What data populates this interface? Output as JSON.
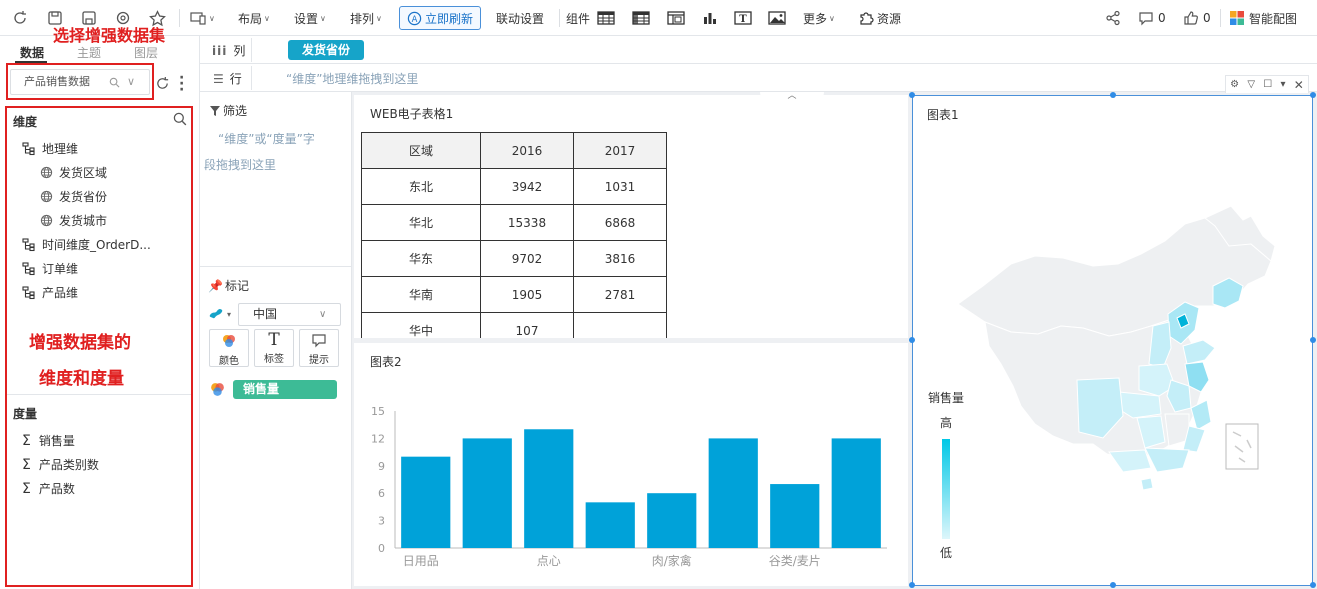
{
  "toolbar": {
    "layout": "布局",
    "settings": "设置",
    "arrange": "排列",
    "refresh": "立即刷新",
    "linkage": "联动设置",
    "component": "组件",
    "more": "更多",
    "resources": "资源",
    "comments_count": "0",
    "likes_count": "0",
    "smart_color": "智能配图"
  },
  "annotations": {
    "choose_dataset": "选择增强数据集",
    "dims_line1": "增强数据集的",
    "dims_line2": "维度和度量"
  },
  "left_panel": {
    "tabs": [
      "数据",
      "主题",
      "图层"
    ],
    "dataset_name": "产品销售数据",
    "dimension_header": "维度",
    "dimensions": [
      {
        "label": "地理维",
        "level": 0
      },
      {
        "label": "发货区域",
        "level": 1
      },
      {
        "label": "发货省份",
        "level": 1
      },
      {
        "label": "发货城市",
        "level": 1
      },
      {
        "label": "时间维度_OrderD...",
        "level": 0
      },
      {
        "label": "订单维",
        "level": 0
      },
      {
        "label": "产品维",
        "level": 0
      }
    ],
    "measure_header": "度量",
    "measures": [
      "销售量",
      "产品类别数",
      "产品数"
    ]
  },
  "shelves": {
    "col_label": "列",
    "col_pill": "发货省份",
    "row_label": "行",
    "row_hint": "“维度”地理维拖拽到这里"
  },
  "filter": {
    "label": "筛选",
    "hint_line1": "“维度”或“度量”字",
    "hint_line2": "段拖拽到这里"
  },
  "marks": {
    "label": "标记",
    "map_select": "中国",
    "buttons": [
      "颜色",
      "标签",
      "提示"
    ],
    "color_field": "销售量"
  },
  "table1": {
    "title": "WEB电子表格1",
    "header": [
      "区域",
      "2016",
      "2017"
    ],
    "rows": [
      [
        "东北",
        "3942",
        "1031"
      ],
      [
        "华北",
        "15338",
        "6868"
      ],
      [
        "华东",
        "9702",
        "3816"
      ],
      [
        "华南",
        "1905",
        "2781"
      ],
      [
        "华中",
        "107",
        ""
      ]
    ]
  },
  "chart2": {
    "title": "图表2"
  },
  "chart_data": {
    "type": "bar",
    "categories": [
      "日用品",
      "",
      "点心",
      "",
      "肉/家禽",
      "",
      "谷类/麦片",
      ""
    ],
    "values": [
      10,
      12,
      13,
      5,
      6,
      12,
      7,
      12
    ],
    "ylim": [
      0,
      15
    ],
    "yticks": [
      0,
      3,
      6,
      9,
      12,
      15
    ],
    "bar_color": "#00a2d9",
    "grid": false
  },
  "chart1": {
    "title": "图表1",
    "legend_title": "销售量",
    "legend_high": "高",
    "legend_low": "低",
    "high_color": "#00c8e6",
    "low_color": "#ddf6fb"
  },
  "colors": {
    "accent_blue": "#4a90d9",
    "annotation_red": "#e02020",
    "pill_teal": "#16a4c9",
    "pill_green": "#3dbb96"
  }
}
